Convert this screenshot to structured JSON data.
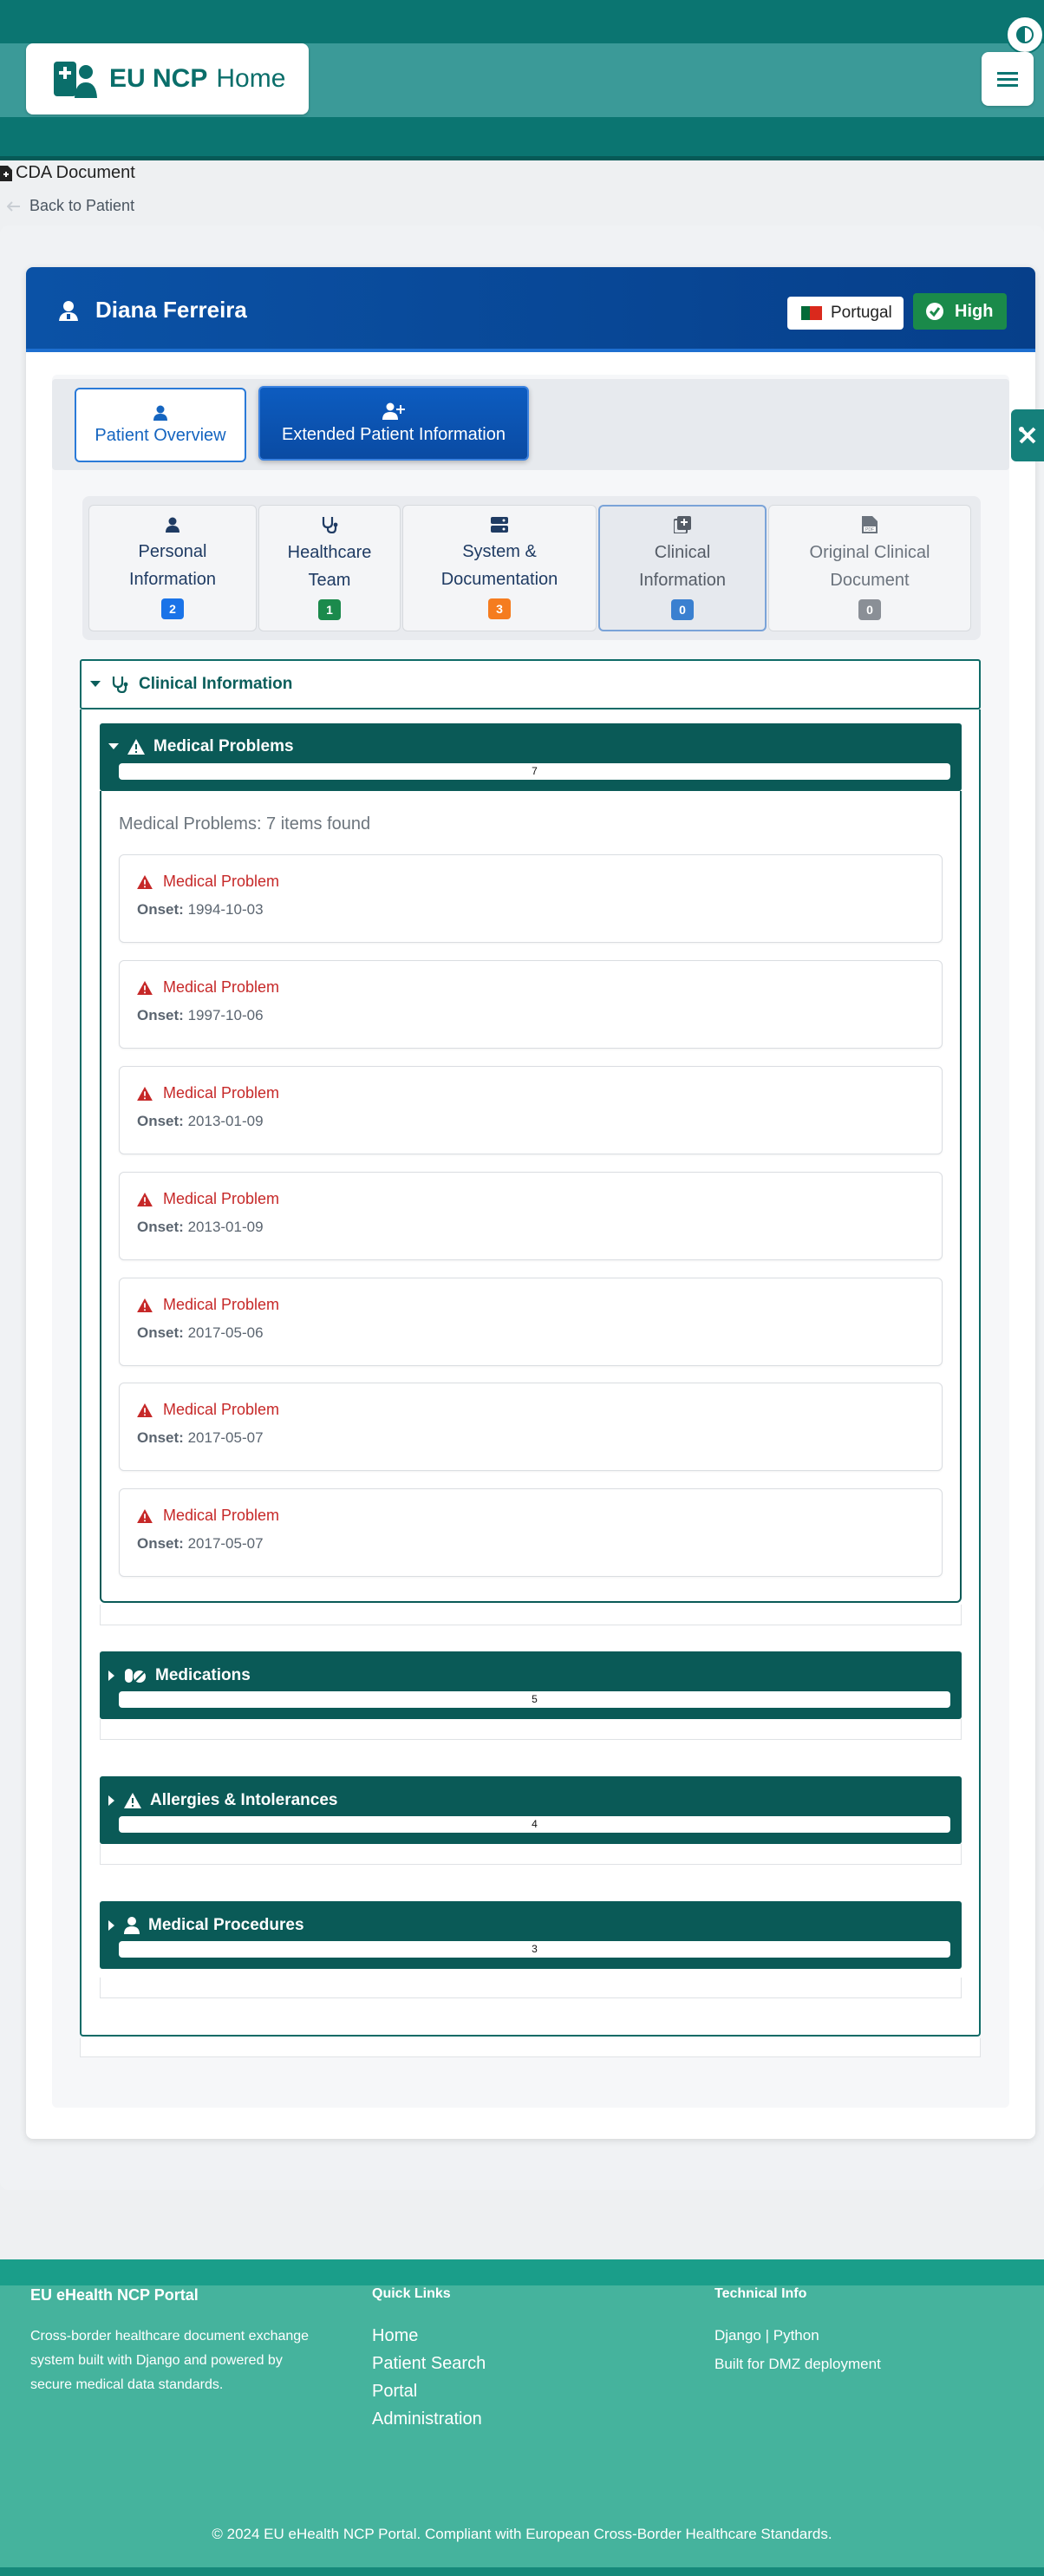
{
  "header": {
    "brand_bold": "EU NCP",
    "brand_rest": "Home"
  },
  "breadcrumb": {
    "label": "CDA Document"
  },
  "back_link": {
    "label": "Back to Patient"
  },
  "patient": {
    "name": "Diana Ferreira",
    "country": "Portugal",
    "level": "High"
  },
  "main_tabs": [
    {
      "label": "Patient Overview"
    },
    {
      "label": "Extended Patient Information"
    }
  ],
  "sub_tabs": [
    {
      "line1": "Personal",
      "line2": "Information",
      "count": "2",
      "color": "#1a73e8"
    },
    {
      "line1": "Healthcare",
      "line2": "Team",
      "count": "1",
      "color": "#1b8a4c"
    },
    {
      "line1": "System &",
      "line2": "Documentation",
      "count": "3",
      "color": "#f57c1f"
    },
    {
      "line1": "Clinical",
      "line2": "Information",
      "count": "0",
      "color": "#3a80d0"
    },
    {
      "line1": "Original Clinical",
      "line2": "Document",
      "count": "0",
      "color": "#8a8f96"
    }
  ],
  "section": {
    "title": "Clinical Information"
  },
  "groups": {
    "medical_problems": {
      "title": "Medical Problems",
      "count": "7",
      "summary": "Medical Problems: 7 items found"
    },
    "medications": {
      "title": "Medications",
      "count": "5"
    },
    "allergies": {
      "title": "Allergies & Intolerances",
      "count": "4"
    },
    "procedures": {
      "title": "Medical Procedures",
      "count": "3"
    }
  },
  "problems": [
    {
      "title": "Medical Problem",
      "onset_label": "Onset:",
      "onset": "1994-10-03"
    },
    {
      "title": "Medical Problem",
      "onset_label": "Onset:",
      "onset": "1997-10-06"
    },
    {
      "title": "Medical Problem",
      "onset_label": "Onset:",
      "onset": "2013-01-09"
    },
    {
      "title": "Medical Problem",
      "onset_label": "Onset:",
      "onset": "2013-01-09"
    },
    {
      "title": "Medical Problem",
      "onset_label": "Onset:",
      "onset": "2017-05-06"
    },
    {
      "title": "Medical Problem",
      "onset_label": "Onset:",
      "onset": "2017-05-07"
    },
    {
      "title": "Medical Problem",
      "onset_label": "Onset:",
      "onset": "2017-05-07"
    }
  ],
  "footer": {
    "about_title": "EU eHealth NCP Portal",
    "about_text": [
      "Cross-border healthcare document exchange",
      "system built with Django and powered by",
      "secure medical data standards."
    ],
    "links_title": "Quick Links",
    "links": [
      "Home",
      "Patient Search",
      "Portal",
      "Administration"
    ],
    "tech_title": "Technical Info",
    "tech": [
      "Django | Python",
      "Built for DMZ deployment"
    ],
    "copyright": "© 2024 EU eHealth NCP Portal. Compliant with European Cross-Border Healthcare Standards."
  },
  "colors": {
    "primary": "#0b7571",
    "header_blue": "#0b52a6",
    "danger": "#c62828",
    "success": "#1a8a4a"
  }
}
